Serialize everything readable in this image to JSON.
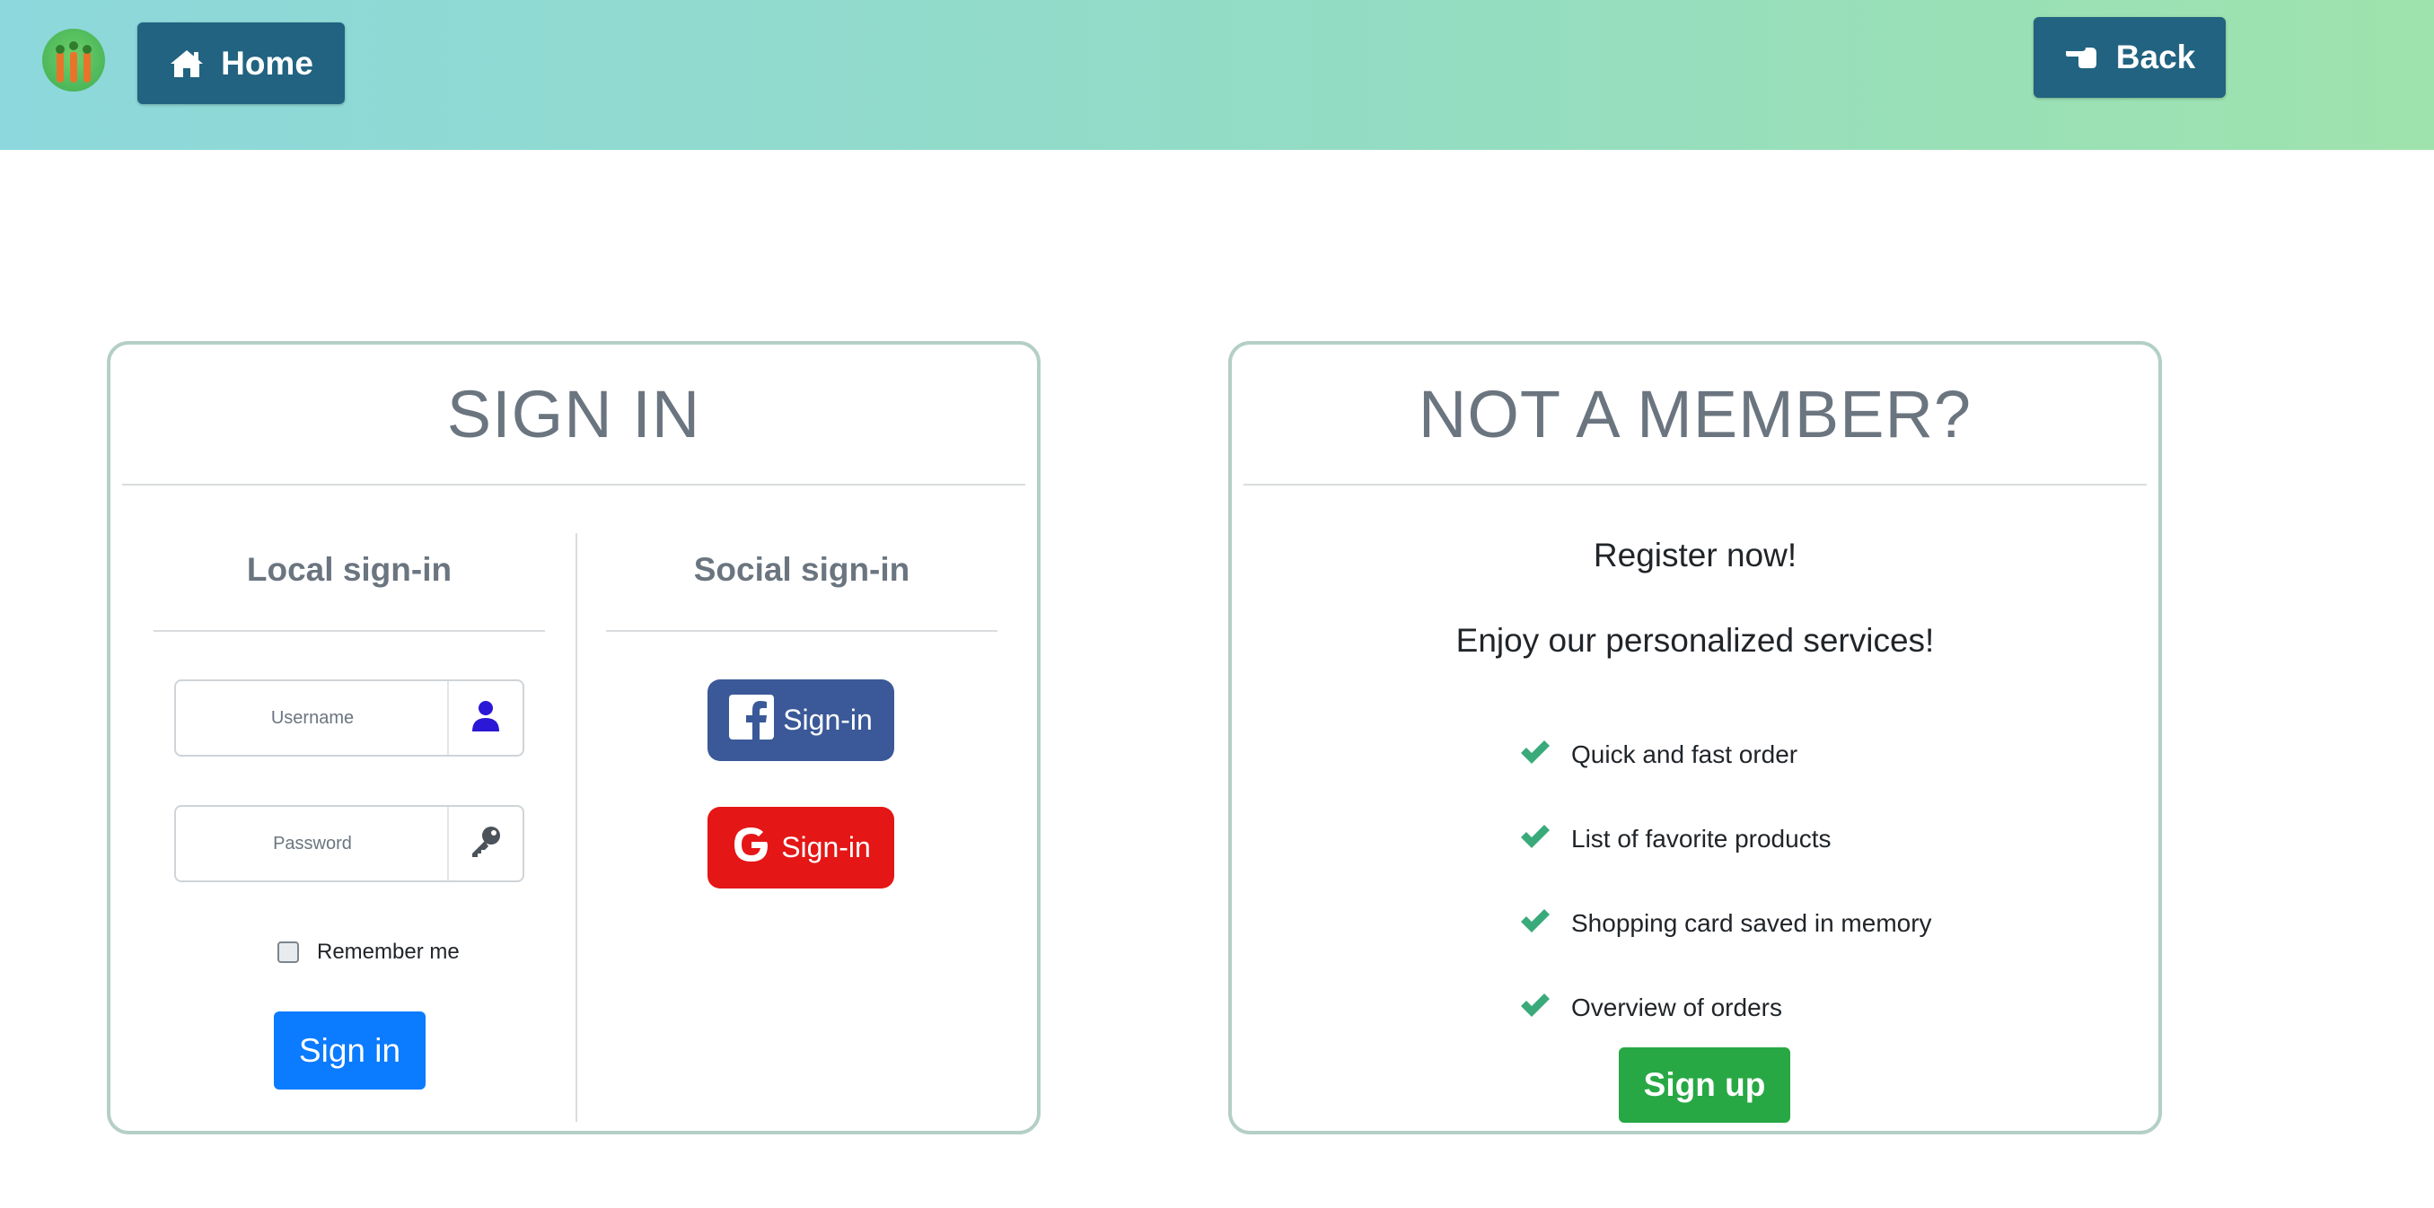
{
  "header": {
    "home_label": "Home",
    "back_label": "Back"
  },
  "signin": {
    "title": "SIGN IN",
    "local_title": "Local sign-in",
    "social_title": "Social sign-in",
    "username_placeholder": "Username",
    "password_placeholder": "Password",
    "remember_label": "Remember me",
    "signin_button": "Sign in",
    "facebook_label": "Sign-in",
    "google_label": "Sign-in"
  },
  "member": {
    "title": "NOT A MEMBER?",
    "register": "Register now!",
    "enjoy": "Enjoy our personalized services!",
    "features": [
      "Quick and fast order",
      "List of favorite products",
      "Shopping card saved in memory",
      "Overview of orders"
    ],
    "signup_button": "Sign up"
  },
  "colors": {
    "header_gradient_start": "#8dd8dc",
    "header_gradient_end": "#9ee3ad",
    "nav_button": "#216380",
    "card_border": "#b4cfc7",
    "primary": "#0b7bff",
    "success": "#27a844",
    "facebook": "#3b5998",
    "google": "#e51616",
    "check": "#3aaa7a"
  }
}
